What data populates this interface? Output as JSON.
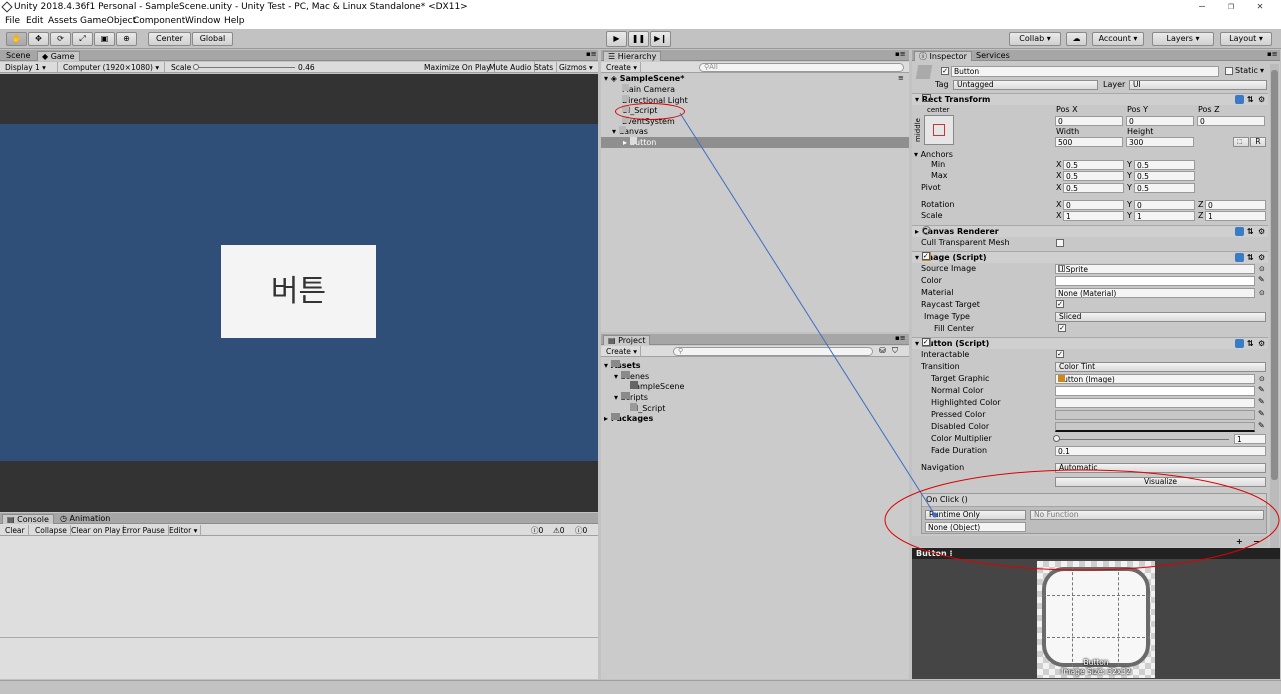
{
  "window": {
    "title": "Unity 2018.4.36f1 Personal - SampleScene.unity - Unity Test - PC, Mac & Linux Standalone* <DX11>",
    "controls": [
      "–",
      "❐",
      "✕"
    ]
  },
  "menu": [
    "File",
    "Edit",
    "Assets",
    "GameObject",
    "Component",
    "Window",
    "Help"
  ],
  "toolbar": {
    "pivot": "Center",
    "space": "Global",
    "collab": "Collab ▾",
    "account": "Account ▾",
    "layers": "Layers ▾",
    "layout": "Layout ▾"
  },
  "game": {
    "tabs": [
      "Scene",
      "Game"
    ],
    "display": "Display 1 ▾",
    "resolution": "Computer (1920×1080) ▾",
    "scale_label": "Scale",
    "scale_value": "0.46",
    "toggles": [
      "Maximize On Play",
      "Mute Audio",
      "Stats",
      "Gizmos ▾"
    ],
    "button_text": "버튼",
    "bg_color": "#2f4f79"
  },
  "console": {
    "tabs": [
      "Console",
      "Animation"
    ],
    "buttons": [
      "Clear",
      "Collapse",
      "Clear on Play",
      "Error Pause",
      "Editor ▾"
    ],
    "counts": [
      "0",
      "0",
      "0"
    ]
  },
  "hierarchy": {
    "tab": "Hierarchy",
    "create": "Create ▾",
    "search_placeholder": "All",
    "scene": "SampleScene*",
    "items": [
      "Main Camera",
      "Directional Light",
      "UI_Script",
      "EventSystem",
      "Canvas",
      "Button"
    ]
  },
  "project": {
    "tab": "Project",
    "create": "Create ▾",
    "tree": [
      "Assets",
      "Scenes",
      "SampleScene",
      "Scripts",
      "UI_Script",
      "Packages"
    ]
  },
  "inspector": {
    "tabs": [
      "Inspector",
      "Services"
    ],
    "object_name": "Button",
    "static_label": "Static",
    "tag_label": "Tag",
    "tag_value": "Untagged",
    "layer_label": "Layer",
    "layer_value": "UI",
    "rect": {
      "title": "Rect Transform",
      "anchor_label": "center",
      "side_label": "middle",
      "posx_label": "Pos X",
      "posy_label": "Pos Y",
      "posz_label": "Pos Z",
      "posx": "0",
      "posy": "0",
      "posz": "0",
      "width_label": "Width",
      "height_label": "Height",
      "width": "500",
      "height": "300",
      "raw_btn": "R",
      "anchors_label": "Anchors",
      "min_label": "Min",
      "max_label": "Max",
      "pivot_label": "Pivot",
      "min_x": "0.5",
      "min_y": "0.5",
      "max_x": "0.5",
      "max_y": "0.5",
      "pivot_x": "0.5",
      "pivot_y": "0.5",
      "rotation_label": "Rotation",
      "scale_label": "Scale",
      "rot_x": "0",
      "rot_y": "0",
      "rot_z": "0",
      "scale_x": "1",
      "scale_y": "1",
      "scale_z": "1",
      "axis_x": "X",
      "axis_y": "Y",
      "axis_z": "Z"
    },
    "canvas_renderer": {
      "title": "Canvas Renderer",
      "cull_label": "Cull Transparent Mesh"
    },
    "image": {
      "title": "Image (Script)",
      "source_label": "Source Image",
      "source_value": "UISprite",
      "color_label": "Color",
      "material_label": "Material",
      "material_value": "None (Material)",
      "raycast_label": "Raycast Target",
      "type_label": "Image Type",
      "type_value": "Sliced",
      "fill_label": "Fill Center"
    },
    "button": {
      "title": "Button (Script)",
      "interactable_label": "Interactable",
      "transition_label": "Transition",
      "transition_value": "Color Tint",
      "target_label": "Target Graphic",
      "target_value": "Button (Image)",
      "normal_label": "Normal Color",
      "highlighted_label": "Highlighted Color",
      "pressed_label": "Pressed Color",
      "disabled_label": "Disabled Color",
      "multiplier_label": "Color Multiplier",
      "multiplier_value": "1",
      "fade_label": "Fade Duration",
      "fade_value": "0.1",
      "navigation_label": "Navigation",
      "navigation_value": "Automatic",
      "visualize_label": "Visualize",
      "onclick_label": "On Click ()",
      "runtime_value": "Runtime Only",
      "function_value": "No Function",
      "object_value": "None (Object)",
      "add_label": "+",
      "remove_label": "−"
    },
    "preview": {
      "title": "Button",
      "caption_name": "Button",
      "caption_size": "Image Size: 32x32"
    }
  }
}
